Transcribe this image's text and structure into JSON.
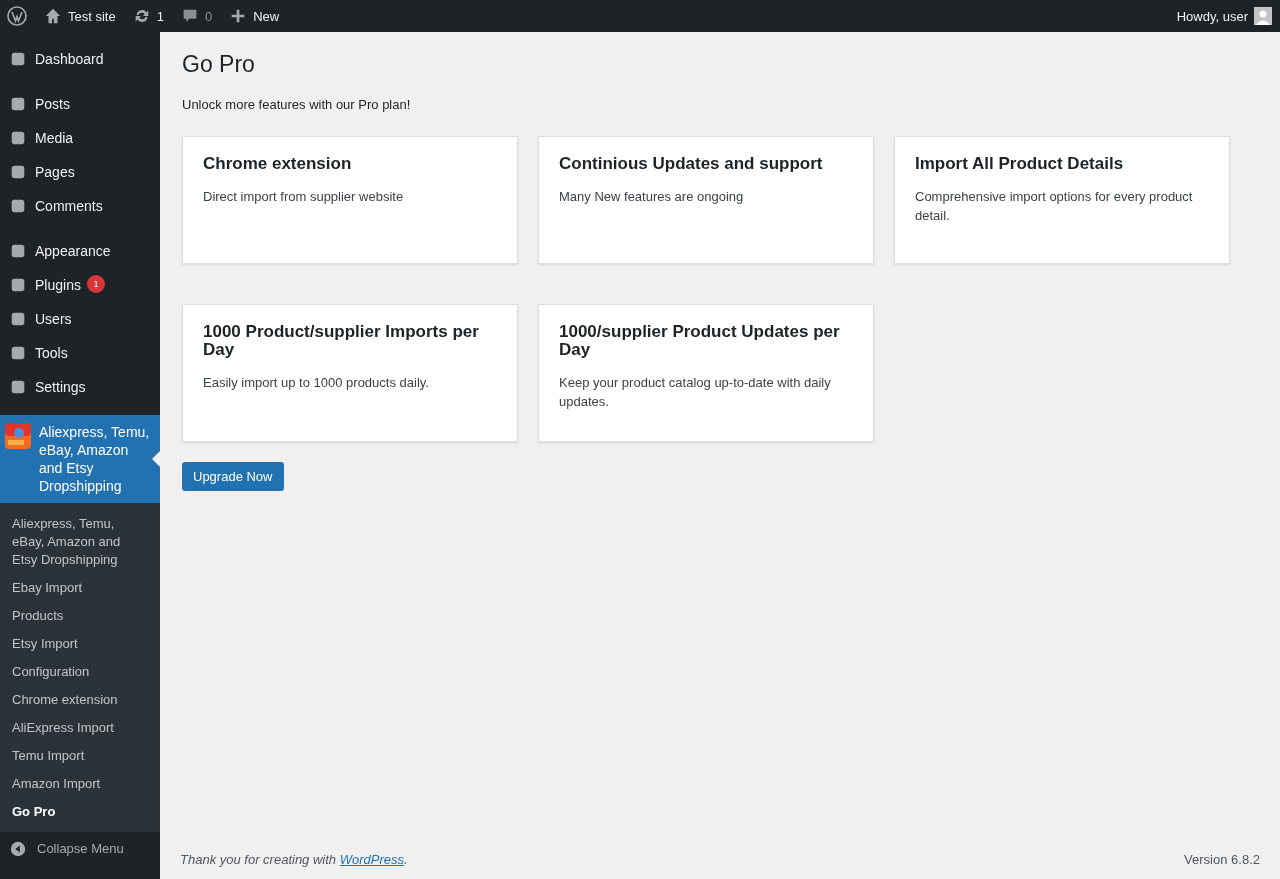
{
  "admin_bar": {
    "site_name": "Test site",
    "updates_count": "1",
    "comments_count": "0",
    "new_label": "New",
    "greeting": "Howdy, user"
  },
  "menu_groups": [
    [
      {
        "label": "Dashboard",
        "selected": false
      }
    ],
    [
      {
        "label": "Posts",
        "selected": false
      },
      {
        "label": "Media",
        "selected": false
      },
      {
        "label": "Pages",
        "selected": false
      },
      {
        "label": "Comments",
        "selected": false
      }
    ],
    [
      {
        "label": "Appearance",
        "selected": false
      },
      {
        "label": "Plugins",
        "selected": false,
        "badge": "1"
      },
      {
        "label": "Users",
        "selected": false
      },
      {
        "label": "Tools",
        "selected": false
      },
      {
        "label": "Settings",
        "selected": false
      }
    ],
    [
      {
        "label": "Aliexpress, Temu, eBay, Amazon and Etsy Dropshipping",
        "selected": true
      }
    ]
  ],
  "submenu": [
    {
      "label": "Aliexpress, Temu, eBay, Amazon and Etsy Dropshipping",
      "selected": false
    },
    {
      "label": "Ebay Import",
      "selected": false
    },
    {
      "label": "Products",
      "selected": false
    },
    {
      "label": "Etsy Import",
      "selected": false
    },
    {
      "label": "Configuration",
      "selected": false
    },
    {
      "label": "Chrome extension",
      "selected": false
    },
    {
      "label": "AliExpress Import",
      "selected": false
    },
    {
      "label": "Temu Import",
      "selected": false
    },
    {
      "label": "Amazon Import",
      "selected": false
    },
    {
      "label": "Go Pro",
      "selected": true
    }
  ],
  "collapse_label": "Collapse Menu",
  "page": {
    "title": "Go Pro",
    "intro": "Unlock more features with our Pro plan!",
    "features": [
      {
        "title": "Chrome extension",
        "description": "Direct import from supplier website"
      },
      {
        "title": "Continious Updates and support",
        "description": "Many New features are ongoing"
      },
      {
        "title": "Import All Product Details",
        "description": "Comprehensive import options for every product detail."
      },
      {
        "title": "1000 Product/supplier Imports per Day",
        "description": "Easily import up to 1000 products daily."
      },
      {
        "title": "1000/supplier Product Updates per Day",
        "description": "Keep your product catalog up-to-date with daily updates."
      }
    ],
    "button": "Upgrade Now"
  },
  "footer": {
    "text_before": "Thank you for creating with ",
    "link": "WordPress",
    "text_after": ".",
    "version": "Version 6.8.2"
  }
}
